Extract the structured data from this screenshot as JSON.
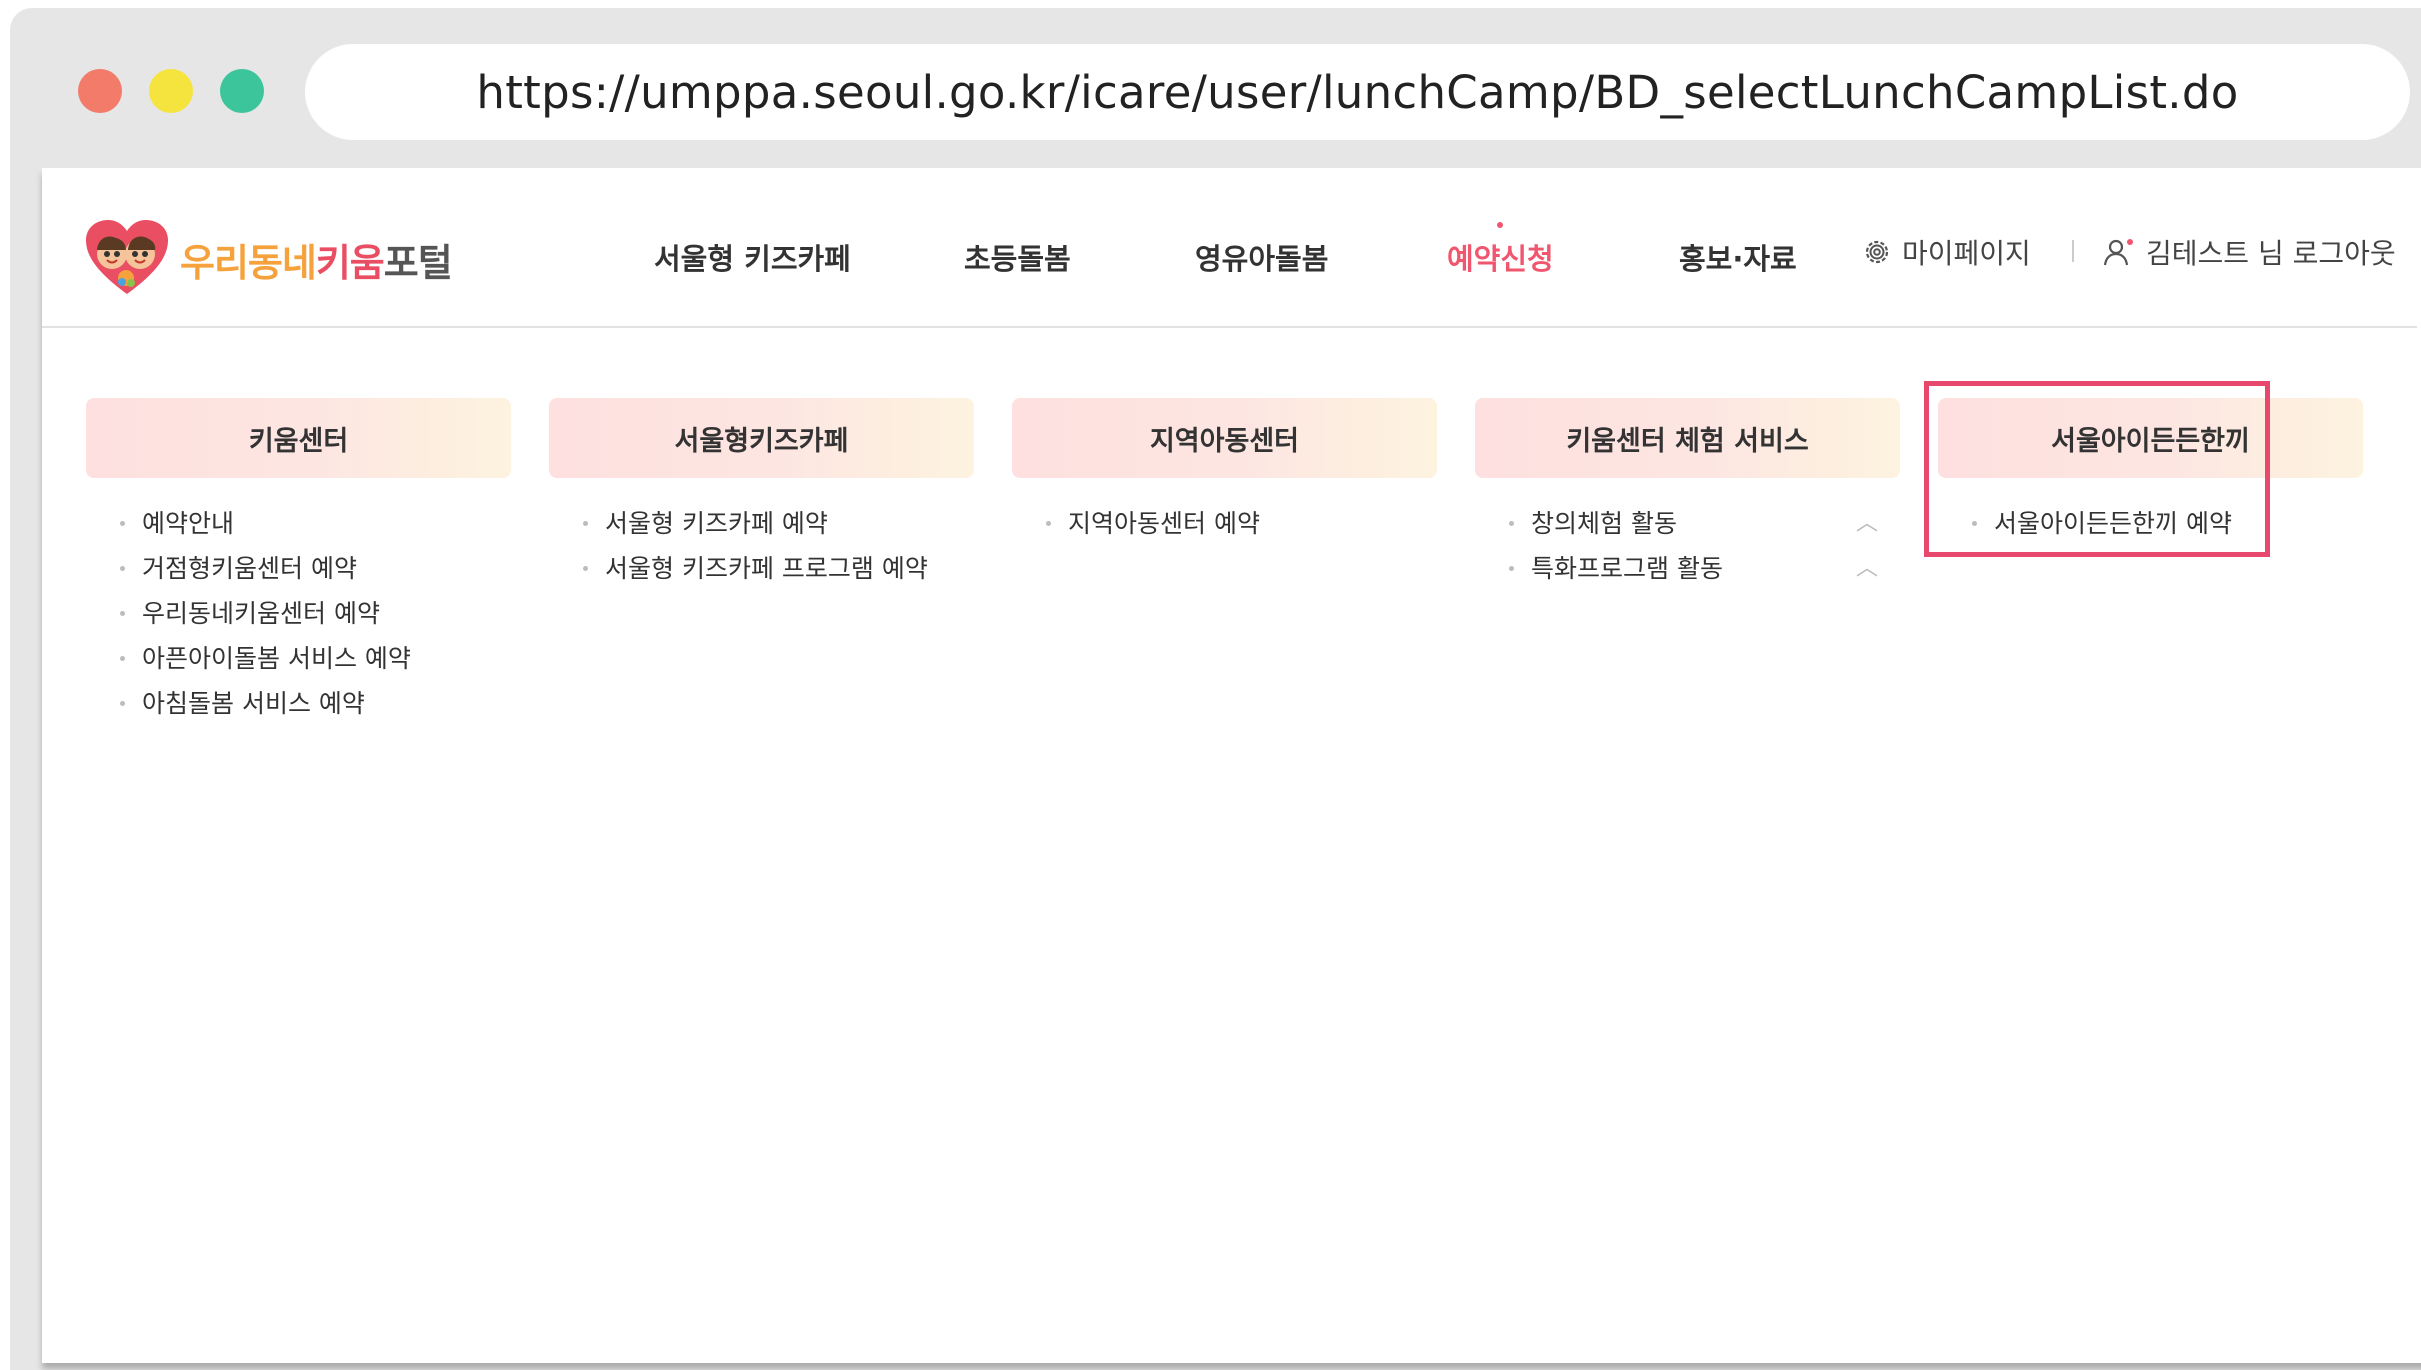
{
  "browser": {
    "url": "https://umppa.seoul.go.kr/icare/user/lunchCamp/BD_selectLunchCampList.do"
  },
  "header": {
    "logo": {
      "title_part1": "우리동네",
      "title_part2": "키움",
      "title_part3": "포털"
    },
    "nav": [
      {
        "label": "서울형 키즈카페"
      },
      {
        "label": "초등돌봄"
      },
      {
        "label": "영유아돌봄"
      },
      {
        "label": "예약신청",
        "active": true
      },
      {
        "label": "홍보·자료"
      }
    ],
    "mypage_label": "마이페이지",
    "user_label": "김테스트 님 로그아웃"
  },
  "menu": {
    "columns": [
      {
        "title": "키움센터",
        "items": [
          "예약안내",
          "거점형키움센터 예약",
          "우리동네키움센터 예약",
          "아픈아이돌봄 서비스 예약",
          "아침돌봄 서비스 예약"
        ]
      },
      {
        "title": "서울형키즈카페",
        "items": [
          "서울형 키즈카페 예약",
          "서울형 키즈카페 프로그램 예약"
        ]
      },
      {
        "title": "지역아동센터",
        "items": [
          "지역아동센터 예약"
        ]
      },
      {
        "title": "키움센터 체험 서비스",
        "items": [
          "창의체험 활동",
          "특화프로그램 활동"
        ]
      },
      {
        "title": "서울아이든든한끼",
        "items": [
          "서울아이든든한끼 예약"
        ],
        "highlighted": true
      }
    ]
  },
  "colors": {
    "accent": "#f0566e",
    "highlight_border": "#e8476e",
    "logo_orange": "#f5a23c",
    "logo_red": "#ea4e63",
    "logo_gray": "#555555"
  }
}
